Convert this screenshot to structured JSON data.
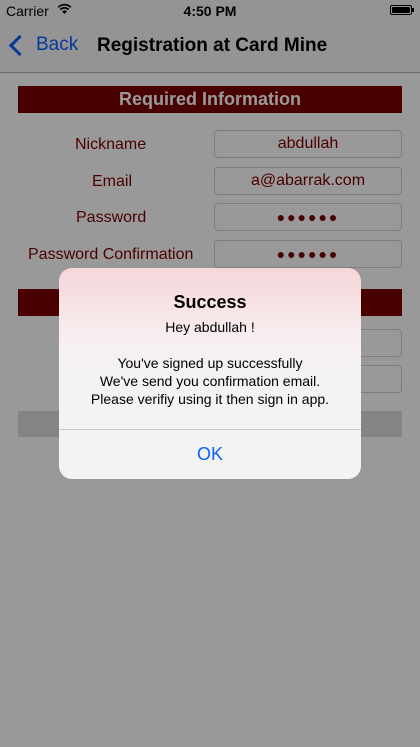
{
  "status_bar": {
    "carrier": "Carrier",
    "time": "4:50 PM"
  },
  "nav": {
    "back_label": "Back",
    "title": "Registration at Card Mine"
  },
  "form": {
    "section_title": "Required Information",
    "fields": [
      {
        "label": "Nickname",
        "value": "abdullah"
      },
      {
        "label": "Email",
        "value": "a@abarrak.com"
      },
      {
        "label": "Password",
        "value": "●●●●●●"
      },
      {
        "label": "Password Confirmation",
        "value": "●●●●●●"
      }
    ]
  },
  "alert": {
    "title": "Success",
    "message": "Hey abdullah !\n\nYou've signed up successfully\nWe've send you confirmation email.\nPlease verifiy using it then sign in app.",
    "ok_label": "OK"
  },
  "colors": {
    "brand": "#7a0000",
    "link": "#0a60ff"
  }
}
